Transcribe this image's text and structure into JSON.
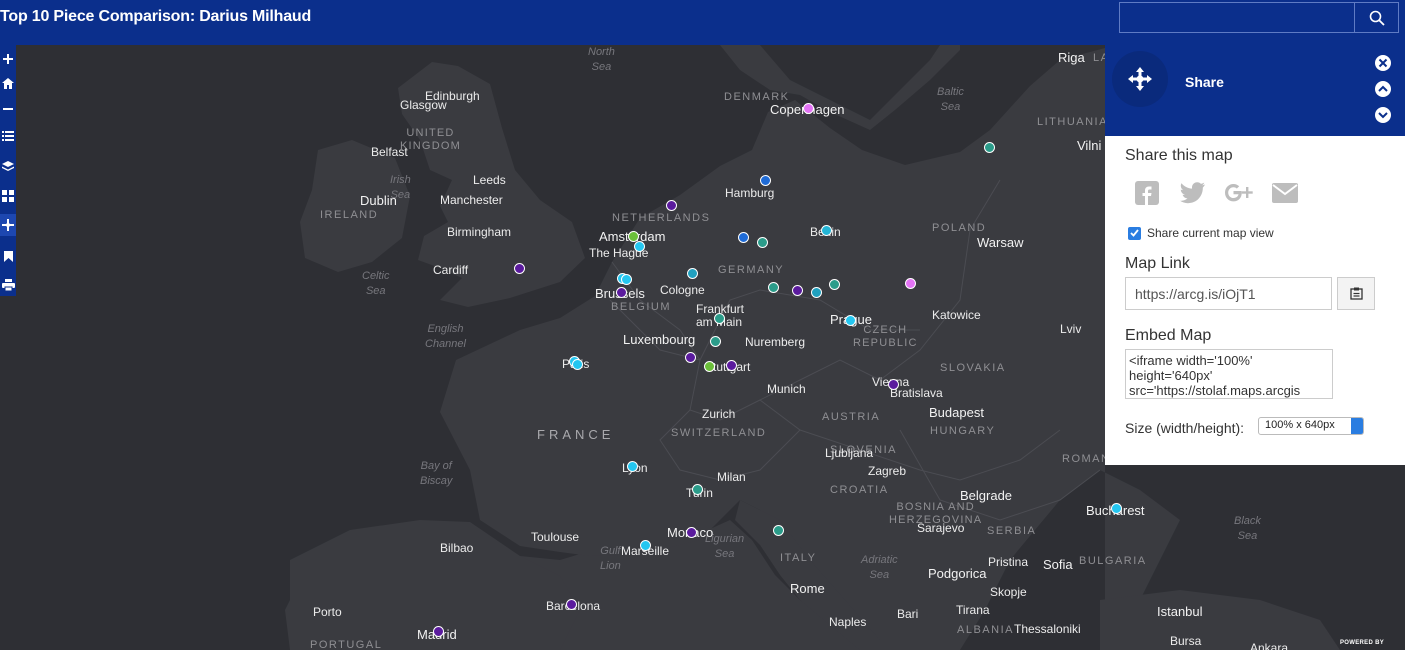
{
  "header": {
    "title": "Top 10 Piece Comparison: Darius Milhaud"
  },
  "search": {
    "placeholder": ""
  },
  "toolbar": {
    "tools": [
      "zoom-in",
      "home",
      "zoom-out",
      "legend",
      "layers",
      "basemap",
      "share",
      "bookmarks",
      "print"
    ]
  },
  "share": {
    "title": "Share",
    "share_this_map": "Share this map",
    "share_current_view_label": "Share current map view",
    "share_current_view_checked": true,
    "map_link_title": "Map Link",
    "map_link": "https://arcg.is/iOjT1",
    "embed_title": "Embed Map",
    "embed_code": "<iframe width='100%' height='640px' src='https://stolaf.maps.arcgis",
    "size_label": "Size (width/height):",
    "size_value": "100% x 640px",
    "social": [
      "facebook-icon",
      "twitter-icon",
      "google-plus-icon",
      "email-icon"
    ]
  },
  "map_labels": {
    "north_sea": "North\nSea",
    "baltic_sea": "Baltic\nSea",
    "irish_sea": "Irish\nSea",
    "celtic_sea": "Celtic\nSea",
    "english_channel": "English\nChannel",
    "bay_biscay": "Bay of\nBiscay",
    "gulf_lion": "Gulf\nLion",
    "ligurian_sea": "Ligurian\nSea",
    "adriatic_sea": "Adriatic\nSea",
    "black_sea": "Black\nSea",
    "riga": "Riga",
    "la": "LA",
    "edinburgh": "Edinburgh",
    "glasgow": "Glasgow",
    "united_kingdom": "UNITED\nKINGDOM",
    "belfast": "Belfast",
    "dublin": "Dublin",
    "ireland": "IRELAND",
    "leeds": "Leeds",
    "manchester": "Manchester",
    "birmingham": "Birmingham",
    "cardiff": "Cardiff",
    "denmark": "DENMARK",
    "copenhagen": "Copenhagen",
    "lithuania": "LITHUANIA",
    "vilnius": "Vilni",
    "hamburg": "Hamburg",
    "netherlands": "NETHERLANDS",
    "amsterdam": "Amsterdam",
    "the_hague": "The Hague",
    "berlin": "Berlin",
    "poland": "POLAND",
    "warsaw": "Warsaw",
    "germany": "GERMANY",
    "brussels": "Brussels",
    "belgium": "BELGIUM",
    "cologne": "Cologne",
    "frankfurt": "Frankfurt\nam Main",
    "luxembourg": "Luxembourg",
    "nuremberg": "Nuremberg",
    "prague": "Prague",
    "czech": "CZECH\nREPUBLIC",
    "katowice": "Katowice",
    "lviv": "Lviv",
    "paris": "Paris",
    "stuttgart": "Stuttgart",
    "munich": "Munich",
    "slovakia": "SLOVAKIA",
    "vienna": "Vienna",
    "bratislava": "Bratislava",
    "budapest": "Budapest",
    "hungary": "HUNGARY",
    "france": "FRANCE",
    "zurich": "Zurich",
    "switzerland": "SWITZERLAND",
    "austria": "AUSTRIA",
    "romania": "ROMAN",
    "slovenia": "SLOVENIA",
    "ljubljana": "Ljubljana",
    "zagreb": "Zagreb",
    "lyon": "Lyon",
    "milan": "Milan",
    "croatia": "CROATIA",
    "turin": "Turin",
    "belgrade": "Belgrade",
    "bucharest": "Bucharest",
    "bosnia": "BOSNIA AND\nHERZEGOVINA",
    "serbia": "SERBIA",
    "sarajevo": "Sarajevo",
    "bilbao": "Bilbao",
    "toulouse": "Toulouse",
    "monaco": "Monaco",
    "marseille": "Marseille",
    "italy": "ITALY",
    "pristina": "Pristina",
    "sofia": "Sofia",
    "bulgaria": "BULGARIA",
    "podgorica": "Podgorica",
    "rome": "Rome",
    "skopje": "Skopje",
    "porto": "Porto",
    "barcelona": "Barcelona",
    "madrid": "Madrid",
    "portugal": "PORTUGAL",
    "naples": "Naples",
    "bari": "Bari",
    "tirana": "Tirana",
    "albania": "ALBANIA",
    "thessaloniki": "Thessaloniki",
    "istanbul": "Istanbul",
    "bursa": "Bursa",
    "ankara": "Ankara"
  },
  "markers": [
    {
      "color": "#e373f5"
    },
    {
      "color": "#2b9c8a"
    },
    {
      "color": "#1f6bd6"
    },
    {
      "color": "#5b1b9e"
    },
    {
      "color": "#1f6bd6"
    },
    {
      "color": "#2b9c8a"
    },
    {
      "color": "#24b5d6"
    },
    {
      "color": "#6bbf3a"
    },
    {
      "color": "#24c6f0"
    },
    {
      "color": "#5b1b9e"
    },
    {
      "color": "#24c6f0"
    },
    {
      "color": "#20a0bf"
    },
    {
      "color": "#2b9c8a"
    },
    {
      "color": "#5b1b9e"
    },
    {
      "color": "#20a0bf"
    },
    {
      "color": "#2b9c8a"
    },
    {
      "color": "#e373f5"
    },
    {
      "color": "#5b1b9e"
    },
    {
      "color": "#2b9c8a"
    },
    {
      "color": "#24c6f0"
    },
    {
      "color": "#2b9c8a"
    },
    {
      "color": "#5b1b9e"
    },
    {
      "color": "#6bbf3a"
    },
    {
      "color": "#5b1b9e"
    },
    {
      "color": "#24c6f0"
    },
    {
      "color": "#24c6f0"
    },
    {
      "color": "#5b1b9e"
    },
    {
      "color": "#24c6f0"
    },
    {
      "color": "#2b9c8a"
    },
    {
      "color": "#2b9c8a"
    },
    {
      "color": "#5b1b9e"
    },
    {
      "color": "#24c6f0"
    },
    {
      "color": "#24c6f0"
    },
    {
      "color": "#5b1b9e"
    },
    {
      "color": "#5b1b9e"
    },
    {
      "color": "#24c6f0"
    }
  ],
  "footer": {
    "powered_by": "POWERED BY"
  }
}
